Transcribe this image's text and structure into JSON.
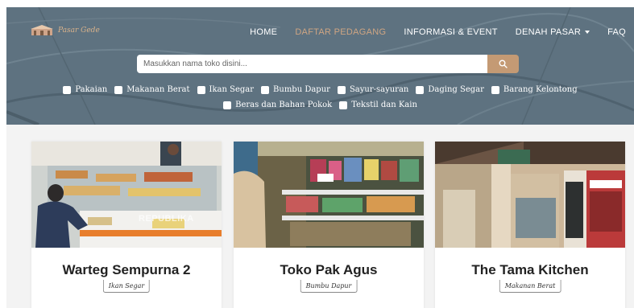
{
  "brand": {
    "name": "Pasar Gede"
  },
  "nav": {
    "home": "HOME",
    "daftar": "DAFTAR PEDAGANG",
    "informasi": "INFORMASI & EVENT",
    "denah": "DENAH PASAR",
    "faq": "FAQ"
  },
  "search": {
    "placeholder": "Masukkan nama toko disini...",
    "value": ""
  },
  "filters": {
    "row1": [
      "Pakaian",
      "Makanan Berat",
      "Ikan Segar",
      "Bumbu Dapur",
      "Sayur-sayuran",
      "Daging Segar",
      "Barang Kelontong"
    ],
    "row2": [
      "Beras dan Bahan Pokok",
      "Tekstil dan Kain"
    ]
  },
  "cards": [
    {
      "title": "Warteg Sempurna 2",
      "tag": "Ikan Segar",
      "watermark": "REPUBLIKA"
    },
    {
      "title": "Toko Pak Agus",
      "tag": "Bumbu Dapur"
    },
    {
      "title": "The Tama Kitchen",
      "tag": "Makanan Berat"
    }
  ],
  "colors": {
    "hero": "#5d7180",
    "accent": "#c49a74",
    "active_nav": "#cfa582"
  }
}
